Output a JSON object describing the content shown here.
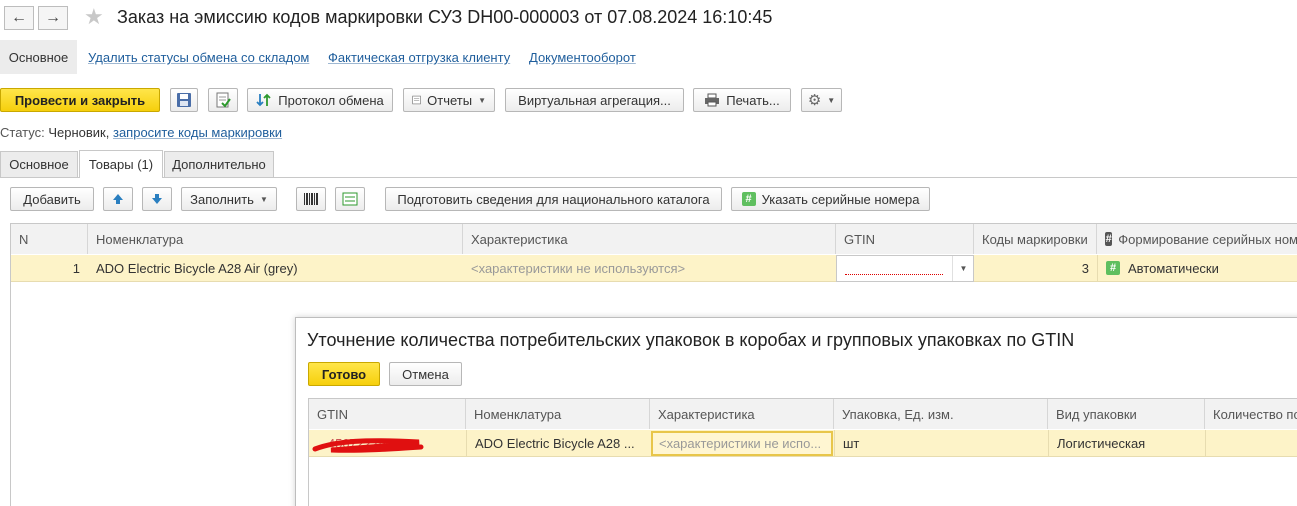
{
  "window": {
    "title": "Заказ на эмиссию кодов маркировки СУЗ DH00-000003 от 07.08.2024 16:10:45"
  },
  "top_nav": {
    "items": [
      {
        "label": "Основное"
      },
      {
        "label": "Удалить статусы обмена со складом"
      },
      {
        "label": "Фактическая отгрузка клиенту"
      },
      {
        "label": "Документооборот"
      }
    ]
  },
  "toolbar": {
    "post_close_label": "Провести и закрыть",
    "exchange_protocol_label": "Протокол обмена",
    "reports_label": "Отчеты",
    "virtual_aggregation_label": "Виртуальная агрегация...",
    "print_label": "Печать..."
  },
  "status": {
    "label": "Статус:",
    "value": "Черновик,",
    "link": "запросите коды маркировки"
  },
  "tabs": [
    {
      "label": "Основное"
    },
    {
      "label": "Товары (1)"
    },
    {
      "label": "Дополнительно"
    }
  ],
  "goods_toolbar": {
    "add_label": "Добавить",
    "fill_label": "Заполнить",
    "prepare_catalog_label": "Подготовить сведения для национального каталога",
    "serial_numbers_label": "Указать серийные номера"
  },
  "goods_table": {
    "columns": [
      "N",
      "Номенклатура",
      "Характеристика",
      "GTIN",
      "Коды маркировки",
      "Формирование серийных ном"
    ],
    "rows": [
      {
        "n": "1",
        "item": "ADO Electric Bicycle A28 Air (grey)",
        "characteristic": "<характеристики не используются>",
        "gtin": "",
        "codes": "3",
        "serial_forming": "Автоматически"
      }
    ]
  },
  "dialog": {
    "title": "Уточнение количества потребительских упаковок в коробах и групповых упаковках по GTIN",
    "ok_label": "Готово",
    "cancel_label": "Отмена",
    "columns": [
      "GTIN",
      "Номенклатура",
      "Характеристика",
      "Упаковка, Ед. изм.",
      "Вид упаковки",
      "Количество по"
    ],
    "rows": [
      {
        "gtin": "...4567222900",
        "item": "ADO Electric Bicycle A28 ...",
        "characteristic": "<характеристики не испо...",
        "unit": "шт",
        "pack_type": "Логистическая",
        "quantity": ""
      }
    ]
  },
  "colors": {
    "accent_yellow": "#f6cf0c",
    "row_highlight": "#fdf3c8",
    "link_blue": "#1f5e9c",
    "redaction_red": "#e01010"
  }
}
